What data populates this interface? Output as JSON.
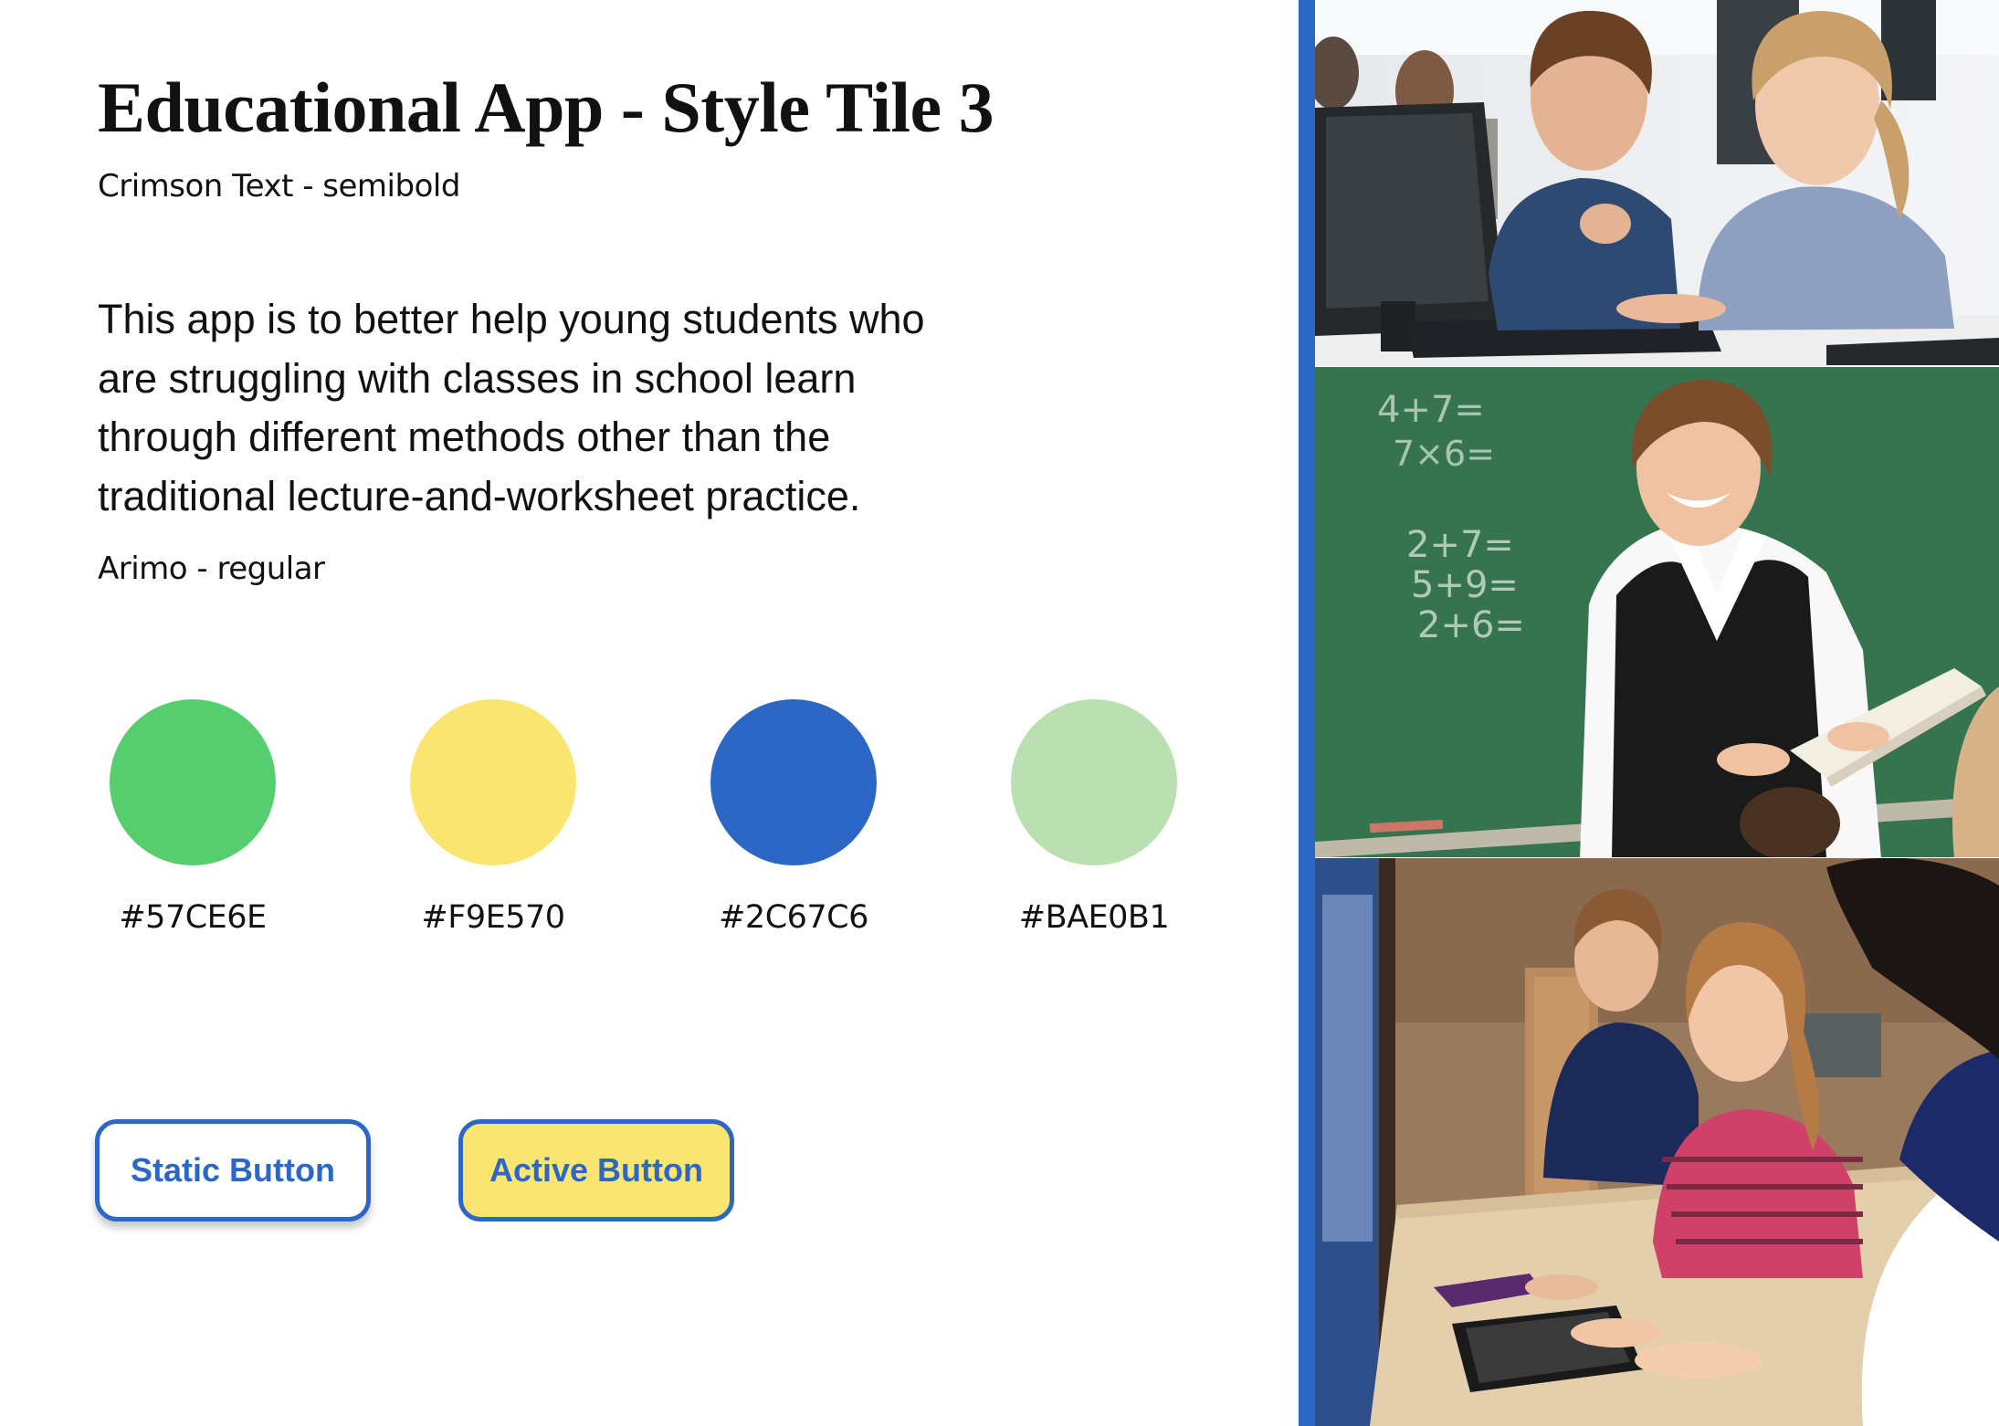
{
  "title": "Educational App - Style Tile 3",
  "heading_font_caption": "Crimson Text - semibold",
  "description": "This app is to better help young students who are struggling with classes in school learn through different methods other than the traditional lecture-and-worksheet practice.",
  "body_font_caption": "Arimo - regular",
  "palette": [
    {
      "hex": "#57CE6E",
      "label": "#57CE6E"
    },
    {
      "hex": "#F9E570",
      "label": "#F9E570"
    },
    {
      "hex": "#2C67C6",
      "label": "#2C67C6"
    },
    {
      "hex": "#BAE0B1",
      "label": "#BAE0B1"
    }
  ],
  "buttons": {
    "static_label": "Static Button",
    "active_label": "Active Button"
  },
  "photos": {
    "chalk_lines": [
      "4+7=",
      "7×6=",
      "2+7=",
      "5+9=",
      "2+6="
    ]
  }
}
